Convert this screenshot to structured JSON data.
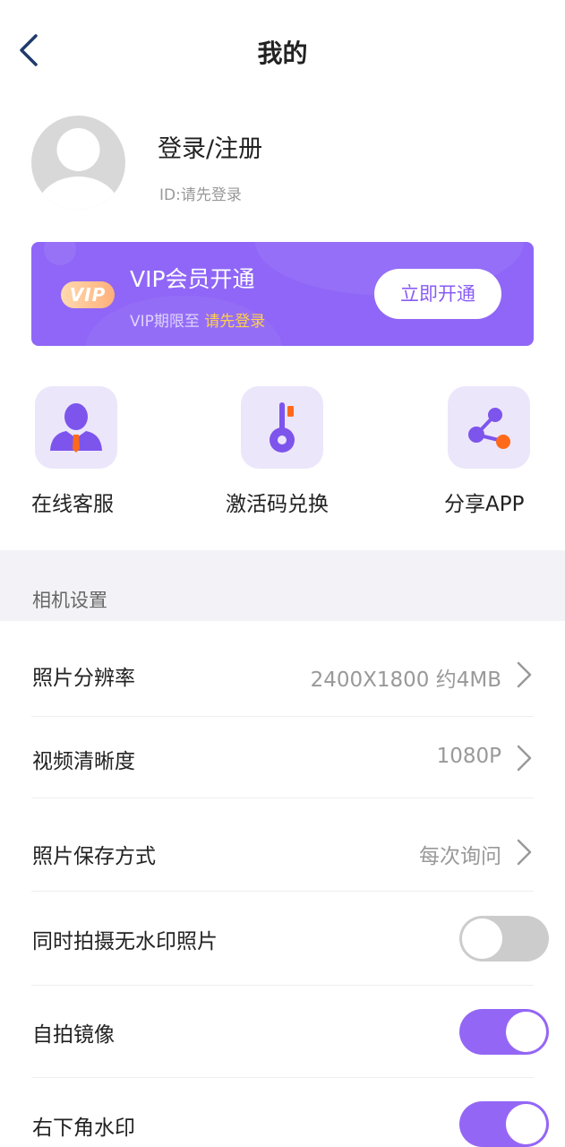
{
  "header": {
    "title": "我的",
    "back_icon": "chevron-left-icon"
  },
  "profile": {
    "login_label": "登录/注册",
    "id_text": "ID:请先登录"
  },
  "vip": {
    "badge": "VIP",
    "title": "VIP会员开通",
    "expiry_prefix": "VIP期限至 ",
    "expiry_value": "请先登录",
    "button_label": "立即开通"
  },
  "quick_actions": [
    {
      "label": "在线客服",
      "icon": "customer-service-icon"
    },
    {
      "label": "激活码兑换",
      "icon": "key-icon"
    },
    {
      "label": "分享APP",
      "icon": "share-icon"
    }
  ],
  "section": {
    "title": "相机设置"
  },
  "settings": [
    {
      "label": "照片分辨率",
      "value": "2400X1800 约4MB"
    },
    {
      "label": "视频清晰度",
      "value": "1080P"
    },
    {
      "label": "照片保存方式",
      "value": "每次询问"
    }
  ],
  "toggles": [
    {
      "label": "同时拍摄无水印照片",
      "on": false
    },
    {
      "label": "自拍镜像",
      "on": true
    },
    {
      "label": "右下角水印",
      "on": true
    }
  ],
  "colors": {
    "accent": "#9466f5",
    "vip_highlight": "#ffd049",
    "icon_orange": "#ff6a1a"
  }
}
